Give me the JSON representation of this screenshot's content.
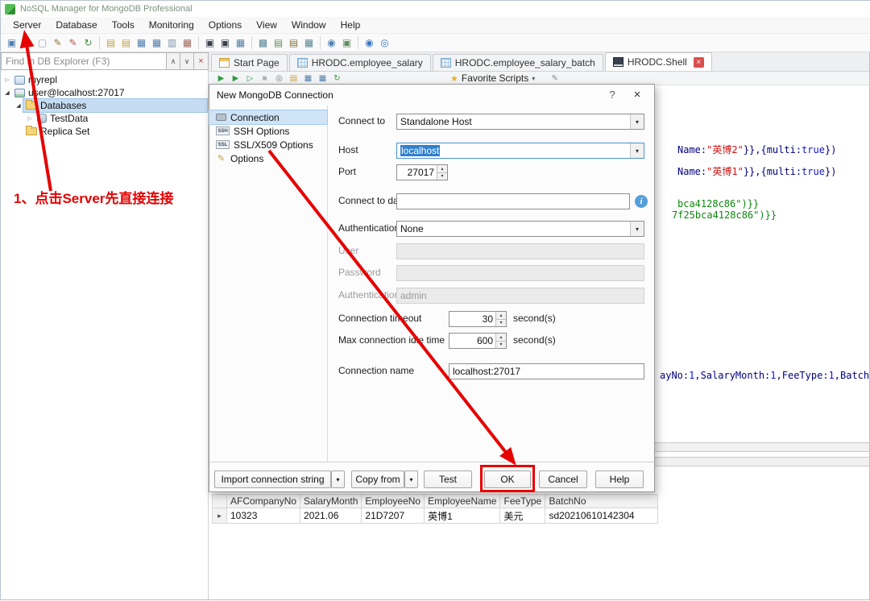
{
  "window": {
    "title": "NoSQL Manager for MongoDB Professional"
  },
  "menu": {
    "items": [
      "Server",
      "Database",
      "Tools",
      "Monitoring",
      "Options",
      "View",
      "Window",
      "Help"
    ]
  },
  "toolbar": {
    "items": [
      {
        "name": "new-connection-icon",
        "glyph": "▣",
        "color": "#4f7fb0"
      },
      {
        "name": "connect-icon",
        "glyph": "▶",
        "color": "#7d94ab"
      },
      {
        "name": "disconnect-icon",
        "glyph": "▢",
        "color": "#90a4b8"
      },
      {
        "name": "edit-connection-icon",
        "glyph": "✎",
        "color": "#8a7340"
      },
      {
        "name": "delete-connection-icon",
        "glyph": "✎",
        "color": "#b2564e"
      },
      {
        "name": "refresh-icon",
        "glyph": "↻",
        "color": "#3d9140"
      },
      {
        "sep": true
      },
      {
        "name": "new-database-icon",
        "glyph": "▤",
        "color": "#c9a23d"
      },
      {
        "name": "open-folder-icon",
        "glyph": "▤",
        "color": "#c9a23d"
      },
      {
        "name": "table-icon",
        "glyph": "▦",
        "color": "#4f7fb0"
      },
      {
        "name": "table-add-icon",
        "glyph": "▦",
        "color": "#4f7fb0"
      },
      {
        "name": "table-view-icon",
        "glyph": "▥",
        "color": "#7d94ab"
      },
      {
        "name": "table-remove-icon",
        "glyph": "▦",
        "color": "#a06a62"
      },
      {
        "sep": true
      },
      {
        "name": "monitor-icon",
        "glyph": "▣",
        "color": "#3a3f4a"
      },
      {
        "name": "shell-window-icon",
        "glyph": "▣",
        "color": "#3a3f4a"
      },
      {
        "name": "grid-view-icon",
        "glyph": "▦",
        "color": "#4f7fb0"
      },
      {
        "sep": true
      },
      {
        "name": "map-reduce-icon",
        "glyph": "▩",
        "color": "#55889b"
      },
      {
        "name": "export-icon",
        "glyph": "▤",
        "color": "#5e8f5e"
      },
      {
        "name": "import-icon",
        "glyph": "▤",
        "color": "#8a7340"
      },
      {
        "name": "aggregate-icon",
        "glyph": "▦",
        "color": "#55889b"
      },
      {
        "sep": true
      },
      {
        "name": "users-icon",
        "glyph": "◉",
        "color": "#4f7fb0"
      },
      {
        "name": "monitor-server-icon",
        "glyph": "▣",
        "color": "#5e8f5e"
      },
      {
        "sep": true
      },
      {
        "name": "help-icon",
        "glyph": "◉",
        "color": "#3d77c2"
      },
      {
        "name": "info-circle-icon",
        "glyph": "◎",
        "color": "#3d77c2"
      }
    ]
  },
  "explorer": {
    "find_text": "Find in DB Explorer (F3)",
    "up_glyph": "∧",
    "down_glyph": "∨",
    "close_glyph": "×",
    "collapsed_glyph": "▷",
    "expanded_glyph": "◢",
    "tree": [
      {
        "label": "myrepl",
        "level": 0,
        "expander": "collapsed",
        "icon": "replica-connection-icon",
        "selected": false
      },
      {
        "label": "user@localhost:27017",
        "level": 0,
        "expander": "expanded",
        "icon": "server-connection-icon",
        "selected": false
      },
      {
        "label": "Databases",
        "level": 1,
        "expander": "expanded",
        "icon": "folder-icon",
        "selected": true
      },
      {
        "label": "TestData",
        "level": 2,
        "expander": "collapsed",
        "icon": "database-icon",
        "selected": false
      },
      {
        "label": "Replica Set",
        "level": 1,
        "expander": "none",
        "icon": "folder-icon",
        "selected": false
      }
    ]
  },
  "tabs": {
    "close_glyph": "×",
    "items": [
      {
        "label": "Start Page",
        "icon": "start-page-icon",
        "active": false,
        "closable": false
      },
      {
        "label": "HRODC.employee_salary",
        "icon": "collection-icon",
        "active": false,
        "closable": false
      },
      {
        "label": "HRODC.employee_salary_batch",
        "icon": "collection-icon",
        "active": false,
        "closable": false
      },
      {
        "label": "HRODC.Shell",
        "icon": "shell-icon",
        "active": true,
        "closable": true
      }
    ]
  },
  "shell_toolbar": {
    "icons": [
      {
        "name": "execute-script-icon",
        "glyph": "▶",
        "color": "#2f9e41"
      },
      {
        "name": "execute-statement-icon",
        "glyph": "▶",
        "color": "#2f9e41"
      },
      {
        "name": "execute-selected-icon",
        "glyph": "▷",
        "color": "#2f9e41"
      },
      {
        "name": "stop-execution-icon",
        "glyph": "■",
        "color": "#aab2ba"
      },
      {
        "name": "find-in-script-icon",
        "glyph": "◎",
        "color": "#6b7b8a"
      },
      {
        "name": "open-script-icon",
        "glyph": "▤",
        "color": "#c9a23d"
      },
      {
        "name": "save-script-icon",
        "glyph": "▦",
        "color": "#4f7fb0"
      },
      {
        "name": "save-script-as-icon",
        "glyph": "▦",
        "color": "#4f7fb0"
      },
      {
        "name": "script-history-icon",
        "glyph": "↻",
        "color": "#2f9e41"
      }
    ],
    "star_glyph": "★",
    "favorite_scripts_label": "Favorite Scripts",
    "dropdown_glyph": "▾",
    "trailing_icon": {
      "name": "shell-options-icon",
      "glyph": "✎",
      "color": "#8a8a8a"
    }
  },
  "shell": {
    "lines": [
      {
        "segments": [
          {
            "text": "Name:",
            "color": "navy"
          },
          {
            "text": "\"英博2\"",
            "color": "red"
          },
          {
            "text": "}},{multi:",
            "color": "navy"
          },
          {
            "text": "true",
            "color": "blue"
          },
          {
            "text": "})",
            "color": "navy"
          }
        ]
      },
      {
        "segments": [
          {
            "text": "Name:",
            "color": "navy"
          },
          {
            "text": "\"英博1\"",
            "color": "red"
          },
          {
            "text": "}},{multi:",
            "color": "navy"
          },
          {
            "text": "true",
            "color": "blue"
          },
          {
            "text": "})",
            "color": "navy"
          }
        ]
      },
      {
        "segments": [
          {
            "text": "bca4128c86\")}}",
            "color": "green"
          }
        ]
      },
      {
        "segments": [
          {
            "text": "7f25bca4128c86\")}}",
            "color": "green"
          }
        ]
      },
      {
        "segments": [
          {
            "text": "ayNo:",
            "color": "navy"
          },
          {
            "text": "1",
            "color": "blue"
          },
          {
            "text": ",SalaryMonth:",
            "color": "navy"
          },
          {
            "text": "1",
            "color": "blue"
          },
          {
            "text": ",FeeType:",
            "color": "navy"
          },
          {
            "text": "1",
            "color": "blue"
          },
          {
            "text": ",BatchNo",
            "color": "navy"
          }
        ]
      }
    ]
  },
  "dialog": {
    "title": "New MongoDB Connection",
    "help_glyph": "?",
    "close_glyph": "×",
    "nav": [
      {
        "label": "Connection",
        "icon": "connection-icon",
        "selected": true
      },
      {
        "label": "SSH Options",
        "icon": "ssh-icon",
        "icon_text": "SSH",
        "selected": false
      },
      {
        "label": "SSL/X509 Options",
        "icon": "ssl-icon",
        "icon_text": "SSL",
        "selected": false
      },
      {
        "label": "Options",
        "icon": "options-icon",
        "icon_glyph": "✎",
        "icon_color": "#c89b3c",
        "selected": false
      }
    ],
    "fields": {
      "connect_to": {
        "label": "Connect to",
        "value": "Standalone Host"
      },
      "host": {
        "label": "Host",
        "value": "localhost"
      },
      "port": {
        "label": "Port",
        "value": "27017"
      },
      "database": {
        "label": "Connect to database",
        "value": ""
      },
      "authentication": {
        "label": "Authentication",
        "value": "None"
      },
      "user": {
        "label": "User",
        "value": ""
      },
      "password": {
        "label": "Password",
        "value": ""
      },
      "auth_db": {
        "label": "Authentication DB",
        "value": "admin"
      },
      "timeout": {
        "label": "Connection timeout",
        "value": "30",
        "suffix": "second(s)"
      },
      "idle": {
        "label": "Max connection idle time",
        "value": "600",
        "suffix": "second(s)"
      },
      "conn_name": {
        "label": "Connection name",
        "value": "localhost:27017"
      }
    },
    "buttons": {
      "import": "Import connection string",
      "copy_from": "Copy from",
      "test": "Test",
      "ok": "OK",
      "cancel": "Cancel",
      "help": "Help"
    }
  },
  "annotation": {
    "step_text": "1、点击Server先直接连接"
  },
  "grid": {
    "columns": [
      "AFCompanyNo",
      "SalaryMonth",
      "EmployeeNo",
      "EmployeeName",
      "FeeType",
      "BatchNo"
    ],
    "rows": [
      [
        "10323",
        "2021.06",
        "21D7207",
        "英博1",
        "美元",
        "sd20210610142304"
      ]
    ]
  },
  "glyphs": {
    "spin_up": "▴",
    "spin_down": "▾",
    "combo_arrow": "▾",
    "info_icon": "i",
    "row_marker": "▸"
  },
  "colors": {
    "annotation_red": "#e60000",
    "selection_blue": "#2f80d0"
  }
}
